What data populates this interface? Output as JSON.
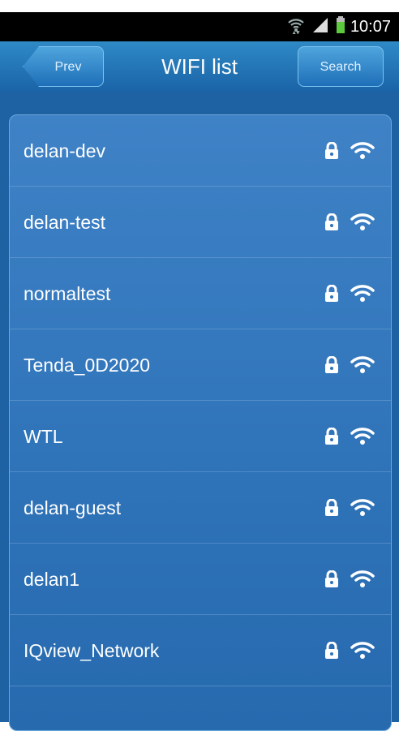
{
  "status_bar": {
    "time": "10:07",
    "icons": [
      "wifi-icon",
      "signal-icon",
      "battery-icon"
    ]
  },
  "header": {
    "title": "WIFI list",
    "prev_label": "Prev",
    "search_label": "Search"
  },
  "wifi_list": [
    {
      "ssid": "delan-dev",
      "secured": true,
      "signal_icon": "wifi-signal-icon"
    },
    {
      "ssid": "delan-test",
      "secured": true,
      "signal_icon": "wifi-signal-icon"
    },
    {
      "ssid": "normaltest",
      "secured": true,
      "signal_icon": "wifi-signal-icon"
    },
    {
      "ssid": "Tenda_0D2020",
      "secured": true,
      "signal_icon": "wifi-signal-icon"
    },
    {
      "ssid": "WTL",
      "secured": true,
      "signal_icon": "wifi-signal-icon"
    },
    {
      "ssid": "delan-guest",
      "secured": true,
      "signal_icon": "wifi-signal-icon"
    },
    {
      "ssid": "delan1",
      "secured": true,
      "signal_icon": "wifi-signal-icon"
    },
    {
      "ssid": "IQview_Network",
      "secured": true,
      "signal_icon": "wifi-signal-icon"
    }
  ],
  "colors": {
    "header_bg": "#2f8ac6",
    "list_bg": "#2e72b8",
    "text": "#ffffff"
  }
}
